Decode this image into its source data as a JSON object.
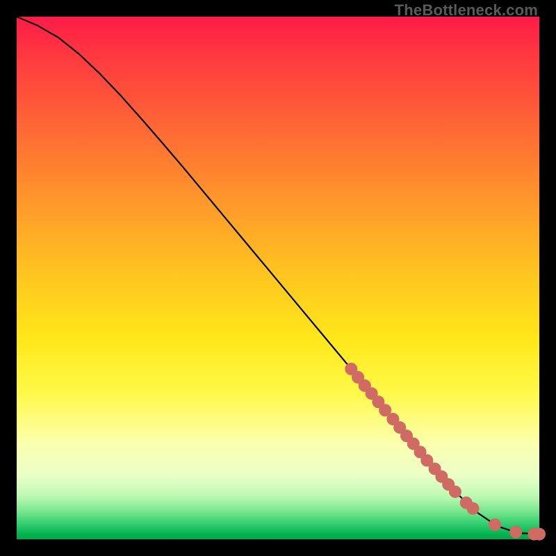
{
  "attribution": "TheBottleneck.com",
  "colors": {
    "marker": "#cf6b63",
    "curve": "#000000",
    "frame": "#000000"
  },
  "chart_data": {
    "type": "line",
    "title": "",
    "xlabel": "",
    "ylabel": "",
    "xlim": [
      0,
      100
    ],
    "ylim": [
      0,
      100
    ],
    "grid": false,
    "legend": false,
    "series": [
      {
        "name": "bottleneck-curve",
        "x": [
          0,
          4,
          8,
          12,
          16,
          20,
          24,
          28,
          32,
          36,
          40,
          44,
          48,
          52,
          56,
          60,
          64,
          68,
          72,
          76,
          80,
          84,
          88,
          92,
          96,
          100
        ],
        "y": [
          100,
          98.3,
          96.0,
          92.8,
          89.0,
          84.8,
          80.3,
          75.7,
          71.0,
          66.2,
          61.4,
          56.6,
          51.8,
          47.0,
          42.2,
          37.4,
          32.6,
          27.8,
          23.0,
          18.2,
          13.5,
          9.0,
          5.2,
          2.5,
          1.2,
          1.0
        ]
      }
    ],
    "markers": [
      {
        "x": 64.0,
        "y": 32.6
      },
      {
        "x": 65.3,
        "y": 31.0
      },
      {
        "x": 66.6,
        "y": 29.4
      },
      {
        "x": 67.9,
        "y": 27.9
      },
      {
        "x": 69.2,
        "y": 26.3
      },
      {
        "x": 70.5,
        "y": 24.7
      },
      {
        "x": 72.0,
        "y": 23.0
      },
      {
        "x": 73.3,
        "y": 21.4
      },
      {
        "x": 74.6,
        "y": 19.8
      },
      {
        "x": 75.9,
        "y": 18.3
      },
      {
        "x": 77.2,
        "y": 16.7
      },
      {
        "x": 78.5,
        "y": 15.1
      },
      {
        "x": 80.0,
        "y": 13.5
      },
      {
        "x": 81.3,
        "y": 12.0
      },
      {
        "x": 82.6,
        "y": 10.5
      },
      {
        "x": 83.9,
        "y": 9.1
      },
      {
        "x": 86.0,
        "y": 7.0
      },
      {
        "x": 87.3,
        "y": 5.9
      },
      {
        "x": 91.5,
        "y": 2.8
      },
      {
        "x": 95.5,
        "y": 1.4
      },
      {
        "x": 99.0,
        "y": 1.0
      },
      {
        "x": 100.0,
        "y": 1.0
      }
    ]
  }
}
